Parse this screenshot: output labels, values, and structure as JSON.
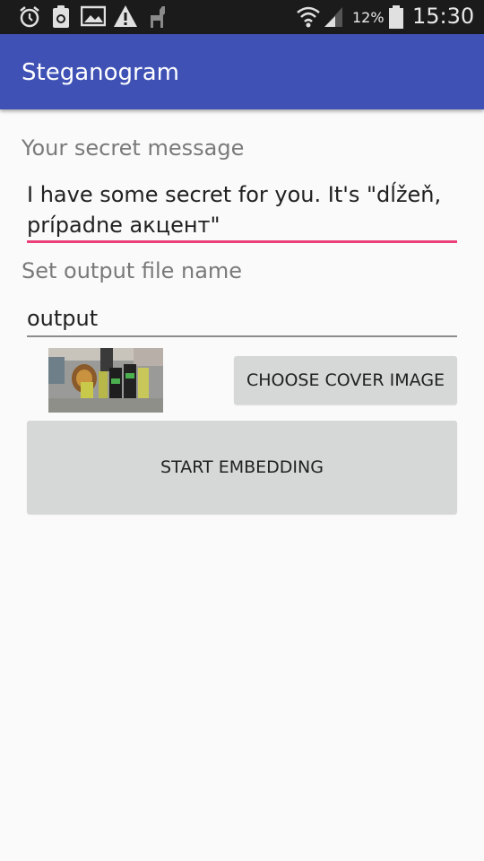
{
  "status_bar": {
    "battery": "12%",
    "time": "15:30",
    "icons": [
      "alarm-icon",
      "recycle-icon",
      "image-icon",
      "warning-icon",
      "llama-icon",
      "wifi-icon",
      "signal-icon",
      "battery-icon"
    ]
  },
  "app_bar": {
    "title": "Steganogram",
    "color": "#3f51b5"
  },
  "form": {
    "message_label": "Your secret message",
    "message_line1": "I have some secret for you. It's \"dĺžeň,",
    "message_line2": "prípadne акцент\"",
    "accent_color": "#ec407a",
    "filename_label": "Set output file name",
    "filename_value": "output"
  },
  "buttons": {
    "choose_cover": "CHOOSE COVER IMAGE",
    "start_embedding": "START EMBEDDING"
  }
}
